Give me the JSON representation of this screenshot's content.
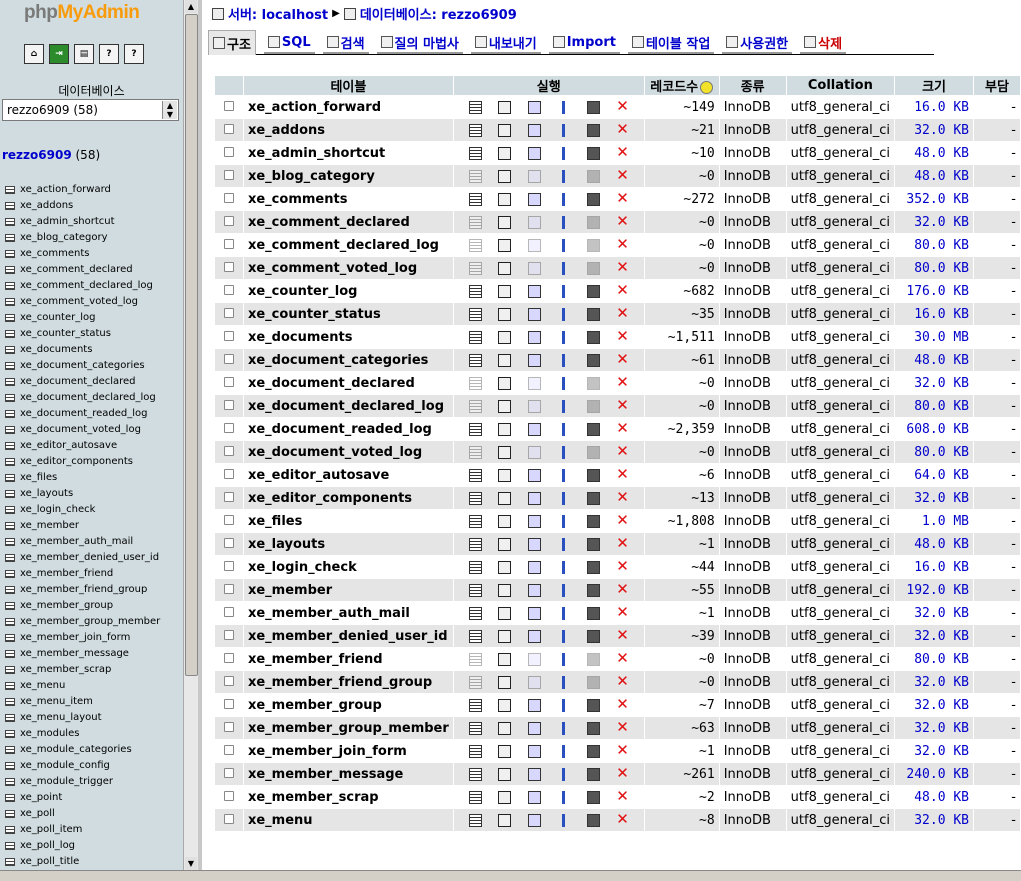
{
  "left": {
    "logo": {
      "php": "php",
      "my": "My",
      "admin": "Admin"
    },
    "icons": [
      "home-icon",
      "exit-icon",
      "sql-icon",
      "query-icon",
      "docs-icon"
    ],
    "db_label": "데이터베이스",
    "db_select": "rezzo6909 (58)",
    "current_db": {
      "name": "rezzo6909",
      "count": "(58)"
    },
    "tables": [
      "xe_action_forward",
      "xe_addons",
      "xe_admin_shortcut",
      "xe_blog_category",
      "xe_comments",
      "xe_comment_declared",
      "xe_comment_declared_log",
      "xe_comment_voted_log",
      "xe_counter_log",
      "xe_counter_status",
      "xe_documents",
      "xe_document_categories",
      "xe_document_declared",
      "xe_document_declared_log",
      "xe_document_readed_log",
      "xe_document_voted_log",
      "xe_editor_autosave",
      "xe_editor_components",
      "xe_files",
      "xe_layouts",
      "xe_login_check",
      "xe_member",
      "xe_member_auth_mail",
      "xe_member_denied_user_id",
      "xe_member_friend",
      "xe_member_friend_group",
      "xe_member_group",
      "xe_member_group_member",
      "xe_member_join_form",
      "xe_member_message",
      "xe_member_scrap",
      "xe_menu",
      "xe_menu_item",
      "xe_menu_layout",
      "xe_modules",
      "xe_module_categories",
      "xe_module_config",
      "xe_module_trigger",
      "xe_point",
      "xe_poll",
      "xe_poll_item",
      "xe_poll_log",
      "xe_poll_title"
    ]
  },
  "breadcrumb": {
    "server_label": "서버: localhost",
    "db_label": "데이터베이스: rezzo6909"
  },
  "tabs": [
    {
      "label": "구조",
      "icon": "structure-icon",
      "active": true
    },
    {
      "label": "SQL",
      "icon": "sql-icon"
    },
    {
      "label": "검색",
      "icon": "search-icon"
    },
    {
      "label": "질의 마법사",
      "icon": "query-icon"
    },
    {
      "label": "내보내기",
      "icon": "export-icon"
    },
    {
      "label": "Import",
      "icon": "import-icon"
    },
    {
      "label": "테이블 작업",
      "icon": "operations-icon"
    },
    {
      "label": "사용권한",
      "icon": "privileges-icon"
    },
    {
      "label": "삭제",
      "icon": "drop-icon"
    }
  ],
  "table": {
    "headers": {
      "table": "테이블",
      "action": "실행",
      "records": "레코드수",
      "type": "종류",
      "collation": "Collation",
      "size": "크기",
      "overhead": "부담"
    },
    "rows": [
      {
        "name": "xe_action_forward",
        "records": "~149",
        "type": "InnoDB",
        "collation": "utf8_general_ci",
        "size": "16.0 KB",
        "overhead": "-",
        "empty": false
      },
      {
        "name": "xe_addons",
        "records": "~21",
        "type": "InnoDB",
        "collation": "utf8_general_ci",
        "size": "32.0 KB",
        "overhead": "-",
        "empty": false
      },
      {
        "name": "xe_admin_shortcut",
        "records": "~10",
        "type": "InnoDB",
        "collation": "utf8_general_ci",
        "size": "48.0 KB",
        "overhead": "-",
        "empty": false
      },
      {
        "name": "xe_blog_category",
        "records": "~0",
        "type": "InnoDB",
        "collation": "utf8_general_ci",
        "size": "48.0 KB",
        "overhead": "-",
        "empty": true
      },
      {
        "name": "xe_comments",
        "records": "~272",
        "type": "InnoDB",
        "collation": "utf8_general_ci",
        "size": "352.0 KB",
        "overhead": "-",
        "empty": false
      },
      {
        "name": "xe_comment_declared",
        "records": "~0",
        "type": "InnoDB",
        "collation": "utf8_general_ci",
        "size": "32.0 KB",
        "overhead": "-",
        "empty": true
      },
      {
        "name": "xe_comment_declared_log",
        "records": "~0",
        "type": "InnoDB",
        "collation": "utf8_general_ci",
        "size": "80.0 KB",
        "overhead": "-",
        "empty": true
      },
      {
        "name": "xe_comment_voted_log",
        "records": "~0",
        "type": "InnoDB",
        "collation": "utf8_general_ci",
        "size": "80.0 KB",
        "overhead": "-",
        "empty": true
      },
      {
        "name": "xe_counter_log",
        "records": "~682",
        "type": "InnoDB",
        "collation": "utf8_general_ci",
        "size": "176.0 KB",
        "overhead": "-",
        "empty": false
      },
      {
        "name": "xe_counter_status",
        "records": "~35",
        "type": "InnoDB",
        "collation": "utf8_general_ci",
        "size": "16.0 KB",
        "overhead": "-",
        "empty": false
      },
      {
        "name": "xe_documents",
        "records": "~1,511",
        "type": "InnoDB",
        "collation": "utf8_general_ci",
        "size": "30.0 MB",
        "overhead": "-",
        "empty": false
      },
      {
        "name": "xe_document_categories",
        "records": "~61",
        "type": "InnoDB",
        "collation": "utf8_general_ci",
        "size": "48.0 KB",
        "overhead": "-",
        "empty": false
      },
      {
        "name": "xe_document_declared",
        "records": "~0",
        "type": "InnoDB",
        "collation": "utf8_general_ci",
        "size": "32.0 KB",
        "overhead": "-",
        "empty": true
      },
      {
        "name": "xe_document_declared_log",
        "records": "~0",
        "type": "InnoDB",
        "collation": "utf8_general_ci",
        "size": "80.0 KB",
        "overhead": "-",
        "empty": true
      },
      {
        "name": "xe_document_readed_log",
        "records": "~2,359",
        "type": "InnoDB",
        "collation": "utf8_general_ci",
        "size": "608.0 KB",
        "overhead": "-",
        "empty": false
      },
      {
        "name": "xe_document_voted_log",
        "records": "~0",
        "type": "InnoDB",
        "collation": "utf8_general_ci",
        "size": "80.0 KB",
        "overhead": "-",
        "empty": true
      },
      {
        "name": "xe_editor_autosave",
        "records": "~6",
        "type": "InnoDB",
        "collation": "utf8_general_ci",
        "size": "64.0 KB",
        "overhead": "-",
        "empty": false
      },
      {
        "name": "xe_editor_components",
        "records": "~13",
        "type": "InnoDB",
        "collation": "utf8_general_ci",
        "size": "32.0 KB",
        "overhead": "-",
        "empty": false
      },
      {
        "name": "xe_files",
        "records": "~1,808",
        "type": "InnoDB",
        "collation": "utf8_general_ci",
        "size": "1.0 MB",
        "overhead": "-",
        "empty": false
      },
      {
        "name": "xe_layouts",
        "records": "~1",
        "type": "InnoDB",
        "collation": "utf8_general_ci",
        "size": "48.0 KB",
        "overhead": "-",
        "empty": false
      },
      {
        "name": "xe_login_check",
        "records": "~44",
        "type": "InnoDB",
        "collation": "utf8_general_ci",
        "size": "16.0 KB",
        "overhead": "-",
        "empty": false
      },
      {
        "name": "xe_member",
        "records": "~55",
        "type": "InnoDB",
        "collation": "utf8_general_ci",
        "size": "192.0 KB",
        "overhead": "-",
        "empty": false
      },
      {
        "name": "xe_member_auth_mail",
        "records": "~1",
        "type": "InnoDB",
        "collation": "utf8_general_ci",
        "size": "32.0 KB",
        "overhead": "-",
        "empty": false
      },
      {
        "name": "xe_member_denied_user_id",
        "records": "~39",
        "type": "InnoDB",
        "collation": "utf8_general_ci",
        "size": "32.0 KB",
        "overhead": "-",
        "empty": false
      },
      {
        "name": "xe_member_friend",
        "records": "~0",
        "type": "InnoDB",
        "collation": "utf8_general_ci",
        "size": "80.0 KB",
        "overhead": "-",
        "empty": true
      },
      {
        "name": "xe_member_friend_group",
        "records": "~0",
        "type": "InnoDB",
        "collation": "utf8_general_ci",
        "size": "32.0 KB",
        "overhead": "-",
        "empty": true
      },
      {
        "name": "xe_member_group",
        "records": "~7",
        "type": "InnoDB",
        "collation": "utf8_general_ci",
        "size": "32.0 KB",
        "overhead": "-",
        "empty": false
      },
      {
        "name": "xe_member_group_member",
        "records": "~63",
        "type": "InnoDB",
        "collation": "utf8_general_ci",
        "size": "32.0 KB",
        "overhead": "-",
        "empty": false
      },
      {
        "name": "xe_member_join_form",
        "records": "~1",
        "type": "InnoDB",
        "collation": "utf8_general_ci",
        "size": "32.0 KB",
        "overhead": "-",
        "empty": false
      },
      {
        "name": "xe_member_message",
        "records": "~261",
        "type": "InnoDB",
        "collation": "utf8_general_ci",
        "size": "240.0 KB",
        "overhead": "-",
        "empty": false
      },
      {
        "name": "xe_member_scrap",
        "records": "~2",
        "type": "InnoDB",
        "collation": "utf8_general_ci",
        "size": "48.0 KB",
        "overhead": "-",
        "empty": false
      },
      {
        "name": "xe_menu",
        "records": "~8",
        "type": "InnoDB",
        "collation": "utf8_general_ci",
        "size": "32.0 KB",
        "overhead": "-",
        "empty": false
      }
    ]
  }
}
